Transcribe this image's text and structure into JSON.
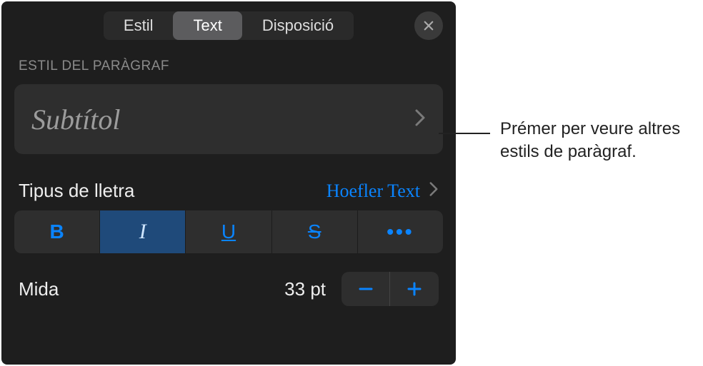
{
  "tabs": {
    "style": "Estil",
    "text": "Text",
    "layout": "Disposició"
  },
  "paragraphStyle": {
    "sectionLabel": "ESTIL DEL PARÀGRAF",
    "current": "Subtítol"
  },
  "font": {
    "label": "Tipus de lletra",
    "value": "Hoefler Text"
  },
  "styleButtons": {
    "bold": "B",
    "italic": "I",
    "underline": "U",
    "strike": "S",
    "more": "•••"
  },
  "size": {
    "label": "Mida",
    "value": "33 pt"
  },
  "callout": "Prémer per veure altres estils de paràgraf."
}
